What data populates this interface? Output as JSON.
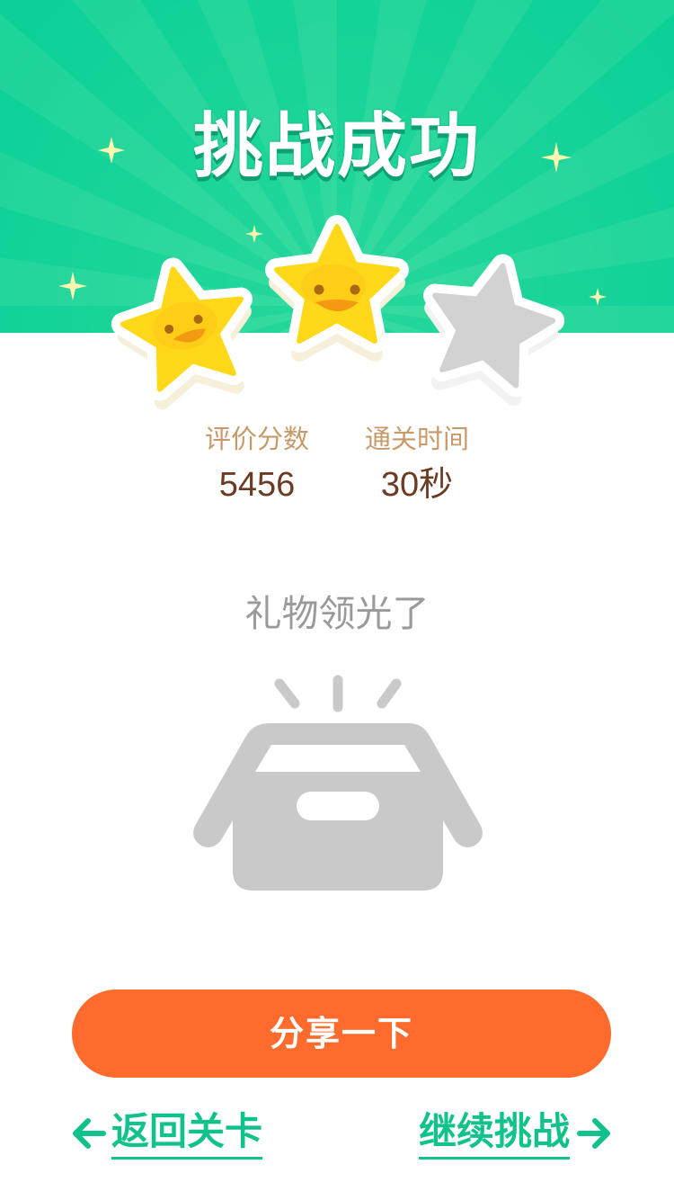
{
  "header": {
    "title": "挑战成功",
    "background_color": "#0cd197",
    "ray_color": "#4ee0a6"
  },
  "rating": {
    "stars_total": 3,
    "stars_earned": 2,
    "star_color": "#ffd81a",
    "empty_star_color": "#d2d2d2"
  },
  "stats": {
    "score_label": "评价分数",
    "score_value": "5456",
    "time_label": "通关时间",
    "time_value": "30秒"
  },
  "gift": {
    "status_text": "礼物领光了",
    "icon": "empty-open-box-icon"
  },
  "actions": {
    "share_label": "分享一下",
    "share_color": "#ff6b2c",
    "back_label": "返回关卡",
    "continue_label": "继续挑战",
    "link_color": "#12c28d"
  }
}
